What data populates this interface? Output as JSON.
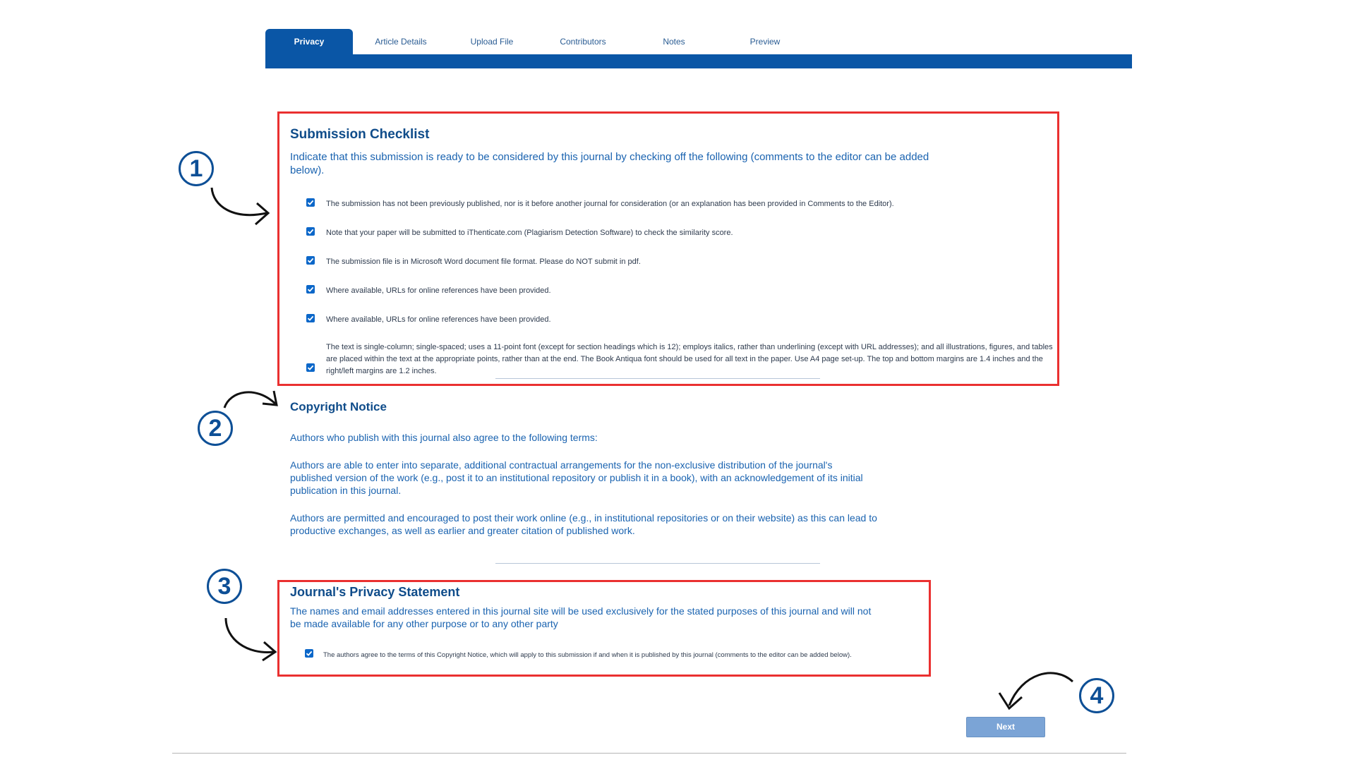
{
  "tabs": [
    {
      "label": "Privacy",
      "active": true
    },
    {
      "label": "Article Details",
      "active": false
    },
    {
      "label": "Upload File",
      "active": false
    },
    {
      "label": "Contributors",
      "active": false
    },
    {
      "label": "Notes",
      "active": false
    },
    {
      "label": "Preview",
      "active": false
    }
  ],
  "checklist": {
    "title": "Submission Checklist",
    "intro": "Indicate that this submission is ready to be considered by this journal by checking off the following (comments to the editor can be added below).",
    "items": [
      {
        "text": "The submission has not been previously published, nor is it before another journal for consideration (or an explanation has been provided in Comments to the Editor).",
        "checked": true
      },
      {
        "text": "Note that your paper will be submitted to iThenticate.com (Plagiarism Detection Software) to check the similarity score.",
        "checked": true
      },
      {
        "text": "The submission file is in Microsoft Word document file format. Please do NOT submit in pdf.",
        "checked": true
      },
      {
        "text": "Where available, URLs for online references have been provided.",
        "checked": true
      },
      {
        "text": "Where available, URLs for online references have been provided.",
        "checked": true
      },
      {
        "text": "The text is single-column; single-spaced; uses a 11-point font (except for section headings which is 12); employs italics, rather than underlining (except with URL addresses); and all illustrations, figures, and tables are placed within the text at the appropriate points, rather than at the end. The Book Antiqua font should be used for all text in the paper. Use A4 page set-up. The top and bottom margins are 1.4 inches and the right/left margins are 1.2 inches.",
        "checked": true
      }
    ]
  },
  "copyright": {
    "title": "Copyright Notice",
    "p1": "Authors who publish with this journal also agree to the following terms:",
    "p2": "Authors are able to enter into separate, additional contractual arrangements for the non-exclusive distribution of the journal's published version of the work (e.g., post it to an institutional repository or publish it in a book), with an acknowledgement of its initial publication in this journal.",
    "p3": "Authors are permitted and encouraged to post their work online (e.g., in institutional repositories or on their website) as this can lead to productive exchanges, as well as earlier and greater citation of published work."
  },
  "privacy": {
    "title": "Journal's Privacy Statement",
    "text": "The names and email addresses entered in this journal site will be used exclusively for the stated purposes of this journal and will not be made available for any other purpose or to any other party",
    "agree_text": "The authors agree to the terms of this Copyright Notice, which will apply to this submission if and when it is published by this journal (comments to the editor can be added below).",
    "agree_checked": true
  },
  "annotations": [
    "1",
    "2",
    "3",
    "4"
  ],
  "next_label": "Next",
  "colors": {
    "primary": "#0a56a6",
    "highlight": "#ea3030",
    "checkbox": "#0b67c9",
    "button": "#7ba4d6"
  }
}
